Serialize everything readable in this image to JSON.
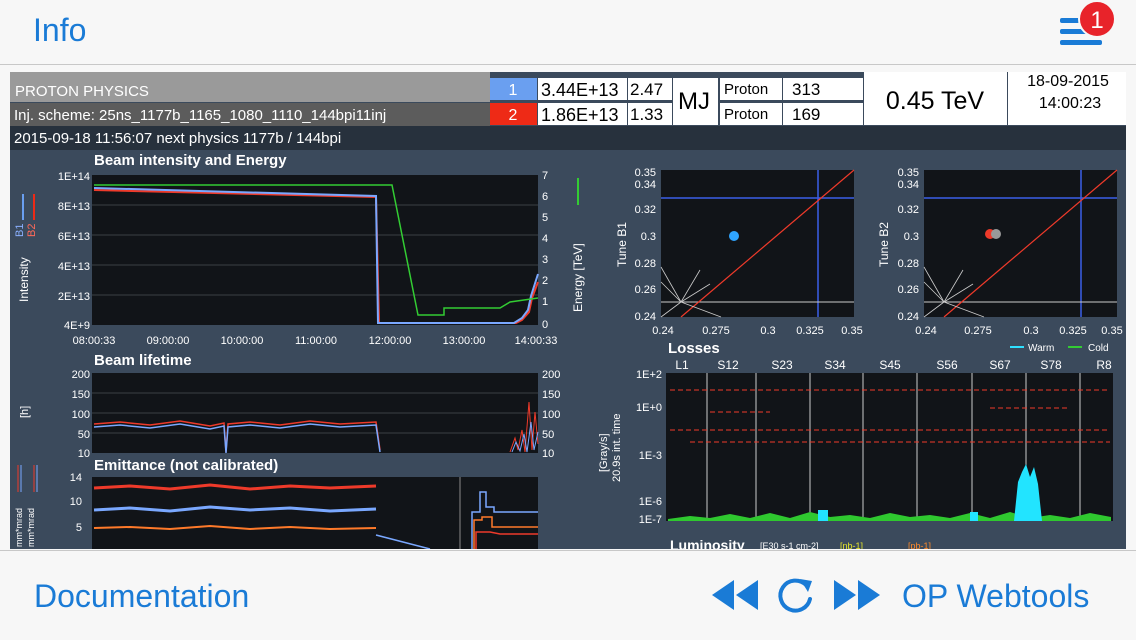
{
  "nav": {
    "back_label": "Info",
    "badge_count": "1",
    "accent_color": "#1a7bd6",
    "badge_color": "#e8232a"
  },
  "header": {
    "mode": "PROTON PHYSICS",
    "scheme": "Inj. scheme: 25ns_1177b_1165_1080_1110_144bpi11inj",
    "status_line": "2015-09-18  11:56:07  next physics 1177b / 144bpi",
    "beams": [
      {
        "index": "1",
        "intensity": "3.44E+13",
        "energy": "2.47",
        "particle": "Proton",
        "bunches": "313",
        "color": "#5f95e8"
      },
      {
        "index": "2",
        "intensity": "1.86E+13",
        "energy": "1.33",
        "particle": "Proton",
        "bunches": "169",
        "color": "#e8301c"
      }
    ],
    "energy_unit": "MJ",
    "beam_energy": "0.45 TeV",
    "date": "18-09-2015",
    "time": "14:00:23"
  },
  "panels": {
    "intensity": {
      "title": "Beam intensity and Energy",
      "ylabel": "Intensity",
      "y2label": "Energy [TeV]",
      "legend": [
        "B1",
        "B2"
      ],
      "yticks": [
        "1E+14",
        "8E+13",
        "6E+13",
        "4E+13",
        "2E+13",
        "4E+9"
      ],
      "y2ticks": [
        "7",
        "6",
        "5",
        "4",
        "3",
        "2",
        "1",
        "0"
      ],
      "xticks": [
        "08:00:33",
        "09:00:00",
        "10:00:00",
        "11:00:00",
        "12:00:00",
        "13:00:00",
        "14:00:33"
      ]
    },
    "lifetime": {
      "title": "Beam lifetime",
      "ylabel": "[h]",
      "yticks": [
        "200",
        "150",
        "100",
        "50",
        "10"
      ],
      "y2ticks": [
        "200",
        "150",
        "100",
        "50",
        "10"
      ]
    },
    "emittance": {
      "title": "Emittance (not calibrated)",
      "ylabel": "mm*mrad",
      "yticks": [
        "14",
        "10",
        "5"
      ]
    },
    "tune_b1": {
      "ylabel": "Tune B1",
      "yticks": [
        "0.35",
        "0.34",
        "0.32",
        "0.3",
        "0.28",
        "0.26",
        "0.24"
      ],
      "xticks": [
        "0.24",
        "0.275",
        "0.3",
        "0.325",
        "0.35"
      ]
    },
    "tune_b2": {
      "ylabel": "Tune B2",
      "yticks": [
        "0.35",
        "0.34",
        "0.32",
        "0.3",
        "0.28",
        "0.26",
        "0.24"
      ],
      "xticks": [
        "0.24",
        "0.275",
        "0.3",
        "0.325",
        "0.35"
      ],
      "legend": [
        "Warm",
        "Cold"
      ]
    },
    "losses": {
      "title": "Losses",
      "ylabel": "[Gray/s]",
      "ylabel2": "20.9s int. time",
      "sectors": [
        "L1",
        "S12",
        "S23",
        "S34",
        "S45",
        "S56",
        "S67",
        "S78",
        "R8"
      ],
      "yticks": [
        "1E+2",
        "1E+0",
        "1E-3",
        "1E-6",
        "1E-7"
      ]
    },
    "luminosity": {
      "title": "Luminosity",
      "unit": "[E30 s-1 cm-2]",
      "series": [
        "[nb-1]",
        "[pb-1]"
      ]
    }
  },
  "bottom": {
    "documentation_label": "Documentation",
    "webtools_label": "OP Webtools"
  }
}
